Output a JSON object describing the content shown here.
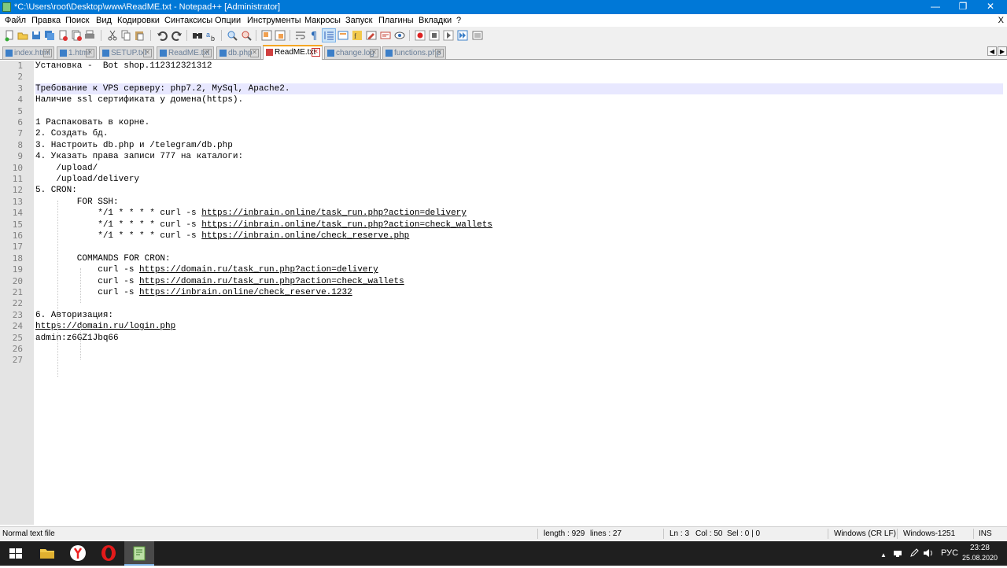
{
  "window": {
    "title": "*C:\\Users\\root\\Desktop\\www\\ReadME.txt - Notepad++ [Administrator]",
    "controls": {
      "minimize": "—",
      "maximize": "❐",
      "close": "✕"
    }
  },
  "menu": {
    "items": [
      "Файл",
      "Правка",
      "Поиск",
      "Вид",
      "Кодировки",
      "Синтаксисы",
      "Опции",
      "Инструменты",
      "Макросы",
      "Запуск",
      "Плагины",
      "Вкладки",
      "?"
    ],
    "close": "X"
  },
  "toolbar": {
    "icons": [
      "new-file-icon",
      "open-file-icon",
      "save-icon",
      "save-all-icon",
      "close-icon",
      "close-all-icon",
      "print-icon",
      "cut-icon",
      "copy-icon",
      "paste-icon",
      "undo-icon",
      "redo-icon",
      "find-icon",
      "replace-icon",
      "zoom-in-icon",
      "zoom-out-icon",
      "sync-vertical-icon",
      "sync-horizontal-icon",
      "word-wrap-icon",
      "show-all-chars-icon",
      "indent-guide-icon",
      "user-language-icon",
      "function-list-icon",
      "folder-workspace-icon",
      "document-map-icon",
      "monitoring-icon",
      "record-macro-icon",
      "stop-record-icon",
      "play-macro-icon",
      "run-multiple-icon",
      "save-macro-icon"
    ]
  },
  "tabs": [
    {
      "label": "index.html",
      "active": false
    },
    {
      "label": "1.html",
      "active": false
    },
    {
      "label": "SETUP.txt",
      "active": false
    },
    {
      "label": "ReadME.txt",
      "active": false
    },
    {
      "label": "db.php",
      "active": false
    },
    {
      "label": "ReadME.txt",
      "active": true
    },
    {
      "label": "change.log",
      "active": false
    },
    {
      "label": "functions.php",
      "active": false
    }
  ],
  "editor": {
    "current_line": 3,
    "lines": [
      {
        "n": "1",
        "text": "Установка -  Bot shop.112312321312"
      },
      {
        "n": "2",
        "text": ""
      },
      {
        "n": "3",
        "text": "Требование к VPS серверу: php7.2, MySql, Apache2."
      },
      {
        "n": "4",
        "text": "Наличие ssl сертификата у домена(https)."
      },
      {
        "n": "5",
        "text": ""
      },
      {
        "n": "6",
        "text": "1 Распаковать в корне."
      },
      {
        "n": "7",
        "text": "2. Создать бд."
      },
      {
        "n": "8",
        "text": "3. Настроить db.php и /telegram/db.php"
      },
      {
        "n": "9",
        "text": "4. Указать права записи 777 на каталоги:"
      },
      {
        "n": "10",
        "text": "    /upload/"
      },
      {
        "n": "11",
        "text": "    /upload/delivery"
      },
      {
        "n": "12",
        "text": "5. CRON:"
      },
      {
        "n": "13",
        "text": "        FOR SSH:"
      },
      {
        "n": "14",
        "text": "            */1 * * * * curl -s ",
        "url": "https://inbrain.online/task_run.php?action=delivery"
      },
      {
        "n": "15",
        "text": "            */1 * * * * curl -s ",
        "url": "https://inbrain.online/task_run.php?action=check_wallets"
      },
      {
        "n": "16",
        "text": "            */1 * * * * curl -s ",
        "url": "https://inbrain.online/check_reserve.php"
      },
      {
        "n": "17",
        "text": ""
      },
      {
        "n": "18",
        "text": "        COMMANDS FOR CRON:"
      },
      {
        "n": "19",
        "text": "            curl -s ",
        "url": "https://domain.ru/task_run.php?action=delivery"
      },
      {
        "n": "20",
        "text": "            curl -s ",
        "url": "https://domain.ru/task_run.php?action=check_wallets"
      },
      {
        "n": "21",
        "text": "            curl -s ",
        "url": "https://inbrain.online/check_reserve.1232"
      },
      {
        "n": "22",
        "text": ""
      },
      {
        "n": "23",
        "text": "6. Авторизация:"
      },
      {
        "n": "24",
        "text": "",
        "url": "https://domain.ru/login.php"
      },
      {
        "n": "25",
        "text": "admin:z6GZ1Jbq66"
      },
      {
        "n": "26",
        "text": ""
      },
      {
        "n": "27",
        "text": ""
      }
    ]
  },
  "status": {
    "file_type": "Normal text file",
    "length": "length : 929",
    "lines": "lines : 27",
    "ln": "Ln : 3",
    "col": "Col : 50",
    "sel": "Sel : 0 | 0",
    "eol": "Windows (CR LF)",
    "encoding": "Windows-1251",
    "mode": "INS"
  },
  "taskbar": {
    "apps": [
      {
        "name": "start-button",
        "active": false
      },
      {
        "name": "file-explorer-app",
        "active": false
      },
      {
        "name": "yandex-browser-app",
        "active": false
      },
      {
        "name": "opera-browser-app",
        "active": false
      },
      {
        "name": "notepad-plus-plus-app",
        "active": true
      }
    ],
    "tray": {
      "chevron": "▲",
      "language": "РУС",
      "time": "23:28",
      "date": "25.08.2020"
    }
  }
}
